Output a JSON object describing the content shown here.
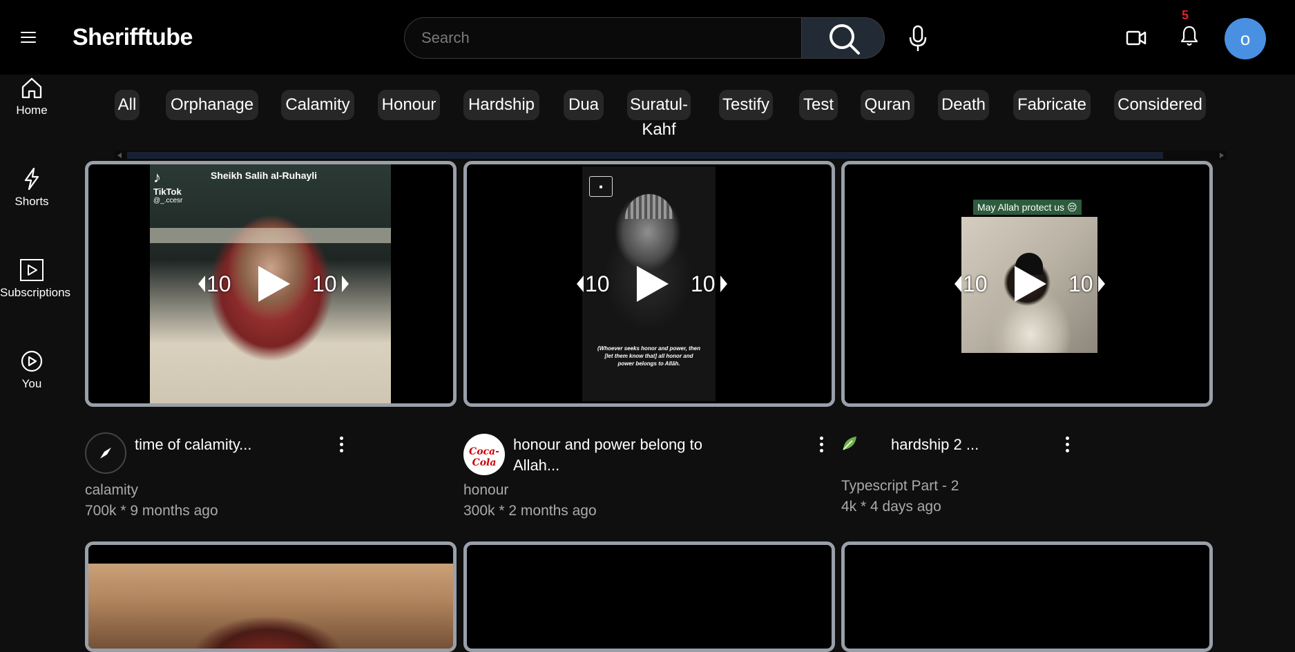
{
  "app": {
    "brand": "Sherifftube"
  },
  "search": {
    "placeholder": "Search"
  },
  "notifications": {
    "count": "5"
  },
  "user": {
    "initial": "o",
    "avatar_color": "#4a90e2"
  },
  "sidebar": {
    "items": [
      {
        "label": "Home",
        "icon": "home-icon"
      },
      {
        "label": "Shorts",
        "icon": "shorts-icon"
      },
      {
        "label": "Subscriptions",
        "icon": "subscriptions-icon"
      },
      {
        "label": "You",
        "icon": "you-icon"
      }
    ]
  },
  "chips": [
    {
      "label": "All"
    },
    {
      "label": "Orphanage"
    },
    {
      "label": "Calamity"
    },
    {
      "label": "Honour"
    },
    {
      "label": "Hardship"
    },
    {
      "label": "Dua"
    },
    {
      "label": "Suratul-",
      "label_line2": "Kahf"
    },
    {
      "label": "Testify"
    },
    {
      "label": "Test"
    },
    {
      "label": "Quran"
    },
    {
      "label": "Death"
    },
    {
      "label": "Fabricate"
    },
    {
      "label": "Considered"
    }
  ],
  "player_controls": {
    "rewind": "10",
    "forward": "10"
  },
  "videos": [
    {
      "title": "time of calamity...",
      "channel": "calamity",
      "stats": "700k * 9 months ago",
      "overlay_text": "Sheikh Salih al-Ruhayli",
      "overlay_badge": "TikTok",
      "overlay_handle": "@_.ccesr",
      "icon": "compass-icon"
    },
    {
      "title": "honour and power belong to Allah...",
      "channel": "honour",
      "stats": "300k * 2 months ago",
      "overlay_text": "(Whoever seeks honor and power, then [let them know that] all honor and power belongs to Allāh.",
      "icon": "coca-cola-logo"
    },
    {
      "title": "hardship 2 ...",
      "channel": "Typescript Part - 2",
      "stats": "4k * 4 days ago",
      "overlay_text": "May Allah protect us 😔",
      "icon": "leaf-icon"
    }
  ],
  "colors": {
    "accent_blue": "#4a90e2",
    "badge_red": "#e0212b",
    "card_border": "#9aa0aa"
  }
}
